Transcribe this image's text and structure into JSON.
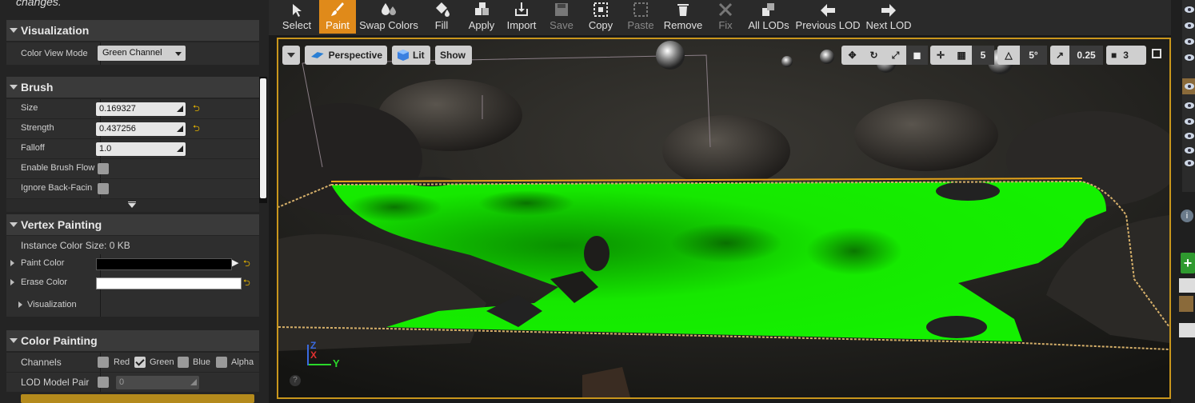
{
  "panel": {
    "top_text": "changes.",
    "visualization": {
      "header": "Visualization",
      "color_view_mode_label": "Color View Mode",
      "color_view_mode_value": "Green Channel"
    },
    "brush": {
      "header": "Brush",
      "size_label": "Size",
      "size_value": "0.169327",
      "strength_label": "Strength",
      "strength_value": "0.437256",
      "falloff_label": "Falloff",
      "falloff_value": "1.0",
      "enable_flow_label": "Enable Brush Flow",
      "enable_flow_checked": false,
      "ignore_backface_label": "Ignore Back-Facin",
      "ignore_backface_checked": false
    },
    "vertex_painting": {
      "header": "Vertex Painting",
      "instance_size": "Instance Color Size: 0 KB",
      "paint_color_label": "Paint Color",
      "paint_color": "#000000",
      "erase_color_label": "Erase Color",
      "erase_color": "#ffffff",
      "visualization_label": "Visualization"
    },
    "color_painting": {
      "header": "Color Painting",
      "channels_label": "Channels",
      "channels": [
        {
          "label": "Red",
          "checked": false
        },
        {
          "label": "Green",
          "checked": true
        },
        {
          "label": "Blue",
          "checked": false
        },
        {
          "label": "Alpha",
          "checked": false
        }
      ],
      "lod_label": "LOD Model Pair",
      "lod_value": "0"
    }
  },
  "toolbar": {
    "buttons": [
      {
        "label": "Select",
        "icon": "cursor-icon",
        "state": "normal"
      },
      {
        "label": "Paint",
        "icon": "brush-icon",
        "state": "active"
      },
      {
        "label": "Swap Colors",
        "icon": "swap-colors-icon",
        "state": "normal"
      },
      {
        "label": "Fill",
        "icon": "fill-bucket-icon",
        "state": "normal"
      },
      {
        "label": "Apply",
        "icon": "apply-cubes-icon",
        "state": "normal"
      },
      {
        "label": "Import",
        "icon": "import-icon",
        "state": "normal"
      },
      {
        "label": "Save",
        "icon": "save-icon",
        "state": "disabled"
      },
      {
        "label": "Copy",
        "icon": "copy-icon",
        "state": "normal"
      },
      {
        "label": "Paste",
        "icon": "paste-icon",
        "state": "disabled"
      },
      {
        "label": "Remove",
        "icon": "trash-icon",
        "state": "normal"
      },
      {
        "label": "Fix",
        "icon": "wrench-icon",
        "state": "disabled"
      },
      {
        "label": "All LODs",
        "icon": "all-lods-icon",
        "state": "normal"
      },
      {
        "label": "Previous LOD",
        "icon": "arrow-left-icon",
        "state": "normal"
      },
      {
        "label": "Next LOD",
        "icon": "arrow-right-icon",
        "state": "normal"
      }
    ]
  },
  "viewport": {
    "view_mode": "Perspective",
    "lighting": "Lit",
    "show": "Show",
    "grid_snap": "5",
    "rotation_snap": "5°",
    "scale_snap": "0.25",
    "camera_speed": "3",
    "axis_x": "X",
    "axis_y": "Y",
    "axis_z": "Z",
    "paint_color": "#14f000"
  },
  "colors": {
    "accent": "#e08a1a",
    "viewport_border": "#c9961c",
    "panel_bg": "#242424"
  }
}
